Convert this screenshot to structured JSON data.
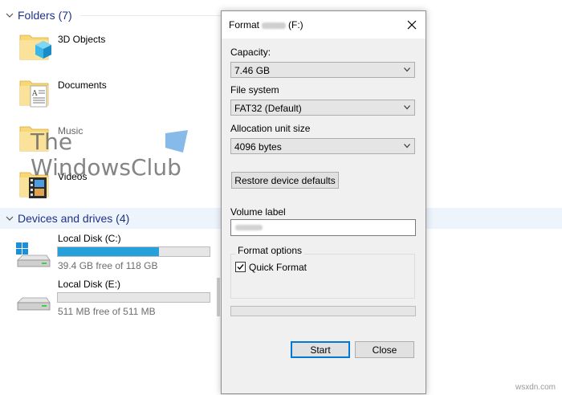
{
  "explorer": {
    "folders_header": "Folders (7)",
    "folders": [
      {
        "label": "3D Objects",
        "icon": "folder-3d-objects-icon"
      },
      {
        "label": "Documents",
        "icon": "folder-documents-icon"
      },
      {
        "label": "Music",
        "icon": "folder-music-icon"
      },
      {
        "label": "Videos",
        "icon": "folder-videos-icon"
      }
    ],
    "devices_header": "Devices and drives (4)",
    "drives": [
      {
        "name": "Local Disk (C:)",
        "free": "39.4 GB free of 118 GB",
        "used_fraction": 0.666,
        "icon": "windows-drive-icon"
      },
      {
        "name": "Local Disk (E:)",
        "free": "511 MB free of 511 MB",
        "used_fraction": 0.0,
        "icon": "drive-icon"
      }
    ]
  },
  "watermark": {
    "line1": "The",
    "line2": "WindowsClub"
  },
  "dialog": {
    "title_prefix": "Format",
    "title_suffix": "(F:)",
    "capacity_label": "Capacity:",
    "capacity_value": "7.46 GB",
    "filesystem_label": "File system",
    "filesystem_value": "FAT32 (Default)",
    "allocation_label": "Allocation unit size",
    "allocation_value": "4096 bytes",
    "restore_button": "Restore device defaults",
    "volume_label": "Volume label",
    "format_options_label": "Format options",
    "quick_format_label": "Quick Format",
    "quick_format_checked": true,
    "start_button": "Start",
    "close_button": "Close"
  },
  "site": "wsxdn.com",
  "colors": {
    "accent": "#0078d7",
    "bar_fill": "#26a0da",
    "header_text": "#1e3287"
  }
}
